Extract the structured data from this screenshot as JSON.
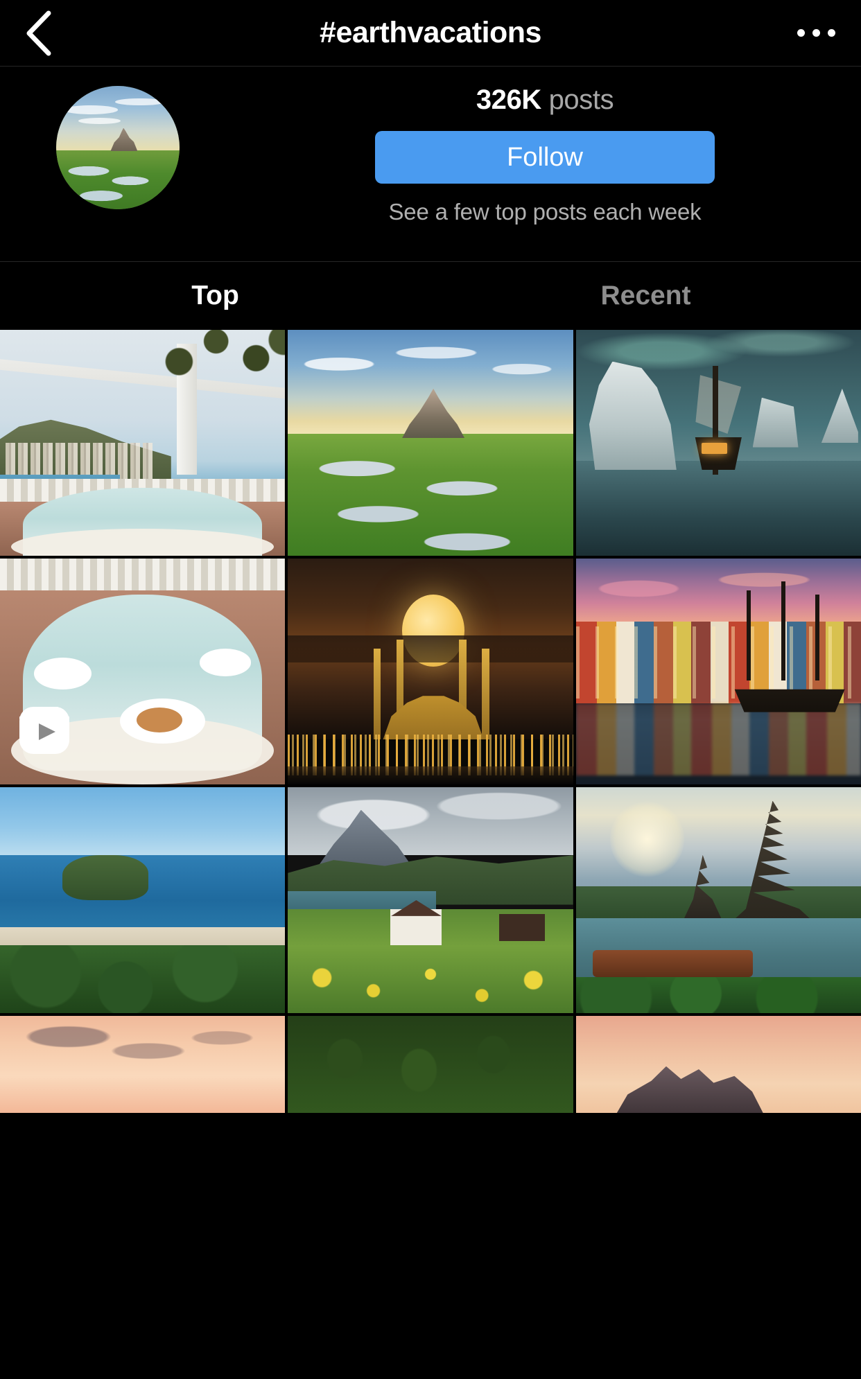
{
  "header": {
    "back_icon": "chevron-left-icon",
    "title": "#earthvacations",
    "more_icon": "more-options-icon"
  },
  "hashtag_info": {
    "avatar_alt": "mont-saint-michel-avatar",
    "post_count": "326K",
    "post_label": "posts",
    "follow_label": "Follow",
    "follow_subtitle": "See a few top posts each week",
    "accent_color": "#4a9bf0"
  },
  "tabs": [
    {
      "label": "Top",
      "active": true
    },
    {
      "label": "Recent",
      "active": false
    }
  ],
  "grid": {
    "reels_badge_icon": "reels-clip-icon",
    "tiles": [
      {
        "id": "tile-1",
        "alt": "positano-balcony-breakfast",
        "is_video": true
      },
      {
        "id": "tile-2",
        "alt": "mont-saint-michel-green-field",
        "is_video": false
      },
      {
        "id": "tile-3",
        "alt": "iceberg-sailing-ship-aurora",
        "is_video": false
      },
      {
        "id": "tile-4",
        "alt": "full-moon-over-mosque",
        "is_video": false
      },
      {
        "id": "tile-5",
        "alt": "nyhavn-colorful-harbour-dusk",
        "is_video": false
      },
      {
        "id": "tile-6",
        "alt": "aerial-coastal-headland-beach",
        "is_video": false
      },
      {
        "id": "tile-7",
        "alt": "alpine-chalet-flower-meadow",
        "is_video": false
      },
      {
        "id": "tile-8",
        "alt": "bali-lake-temple-boat",
        "is_video": false
      },
      {
        "id": "tile-9",
        "alt": "pastel-sunset-sky",
        "is_video": false
      },
      {
        "id": "tile-10",
        "alt": "green-fern-leaves",
        "is_video": false
      },
      {
        "id": "tile-11",
        "alt": "mountain-peaks-at-sunset",
        "is_video": false
      }
    ]
  }
}
